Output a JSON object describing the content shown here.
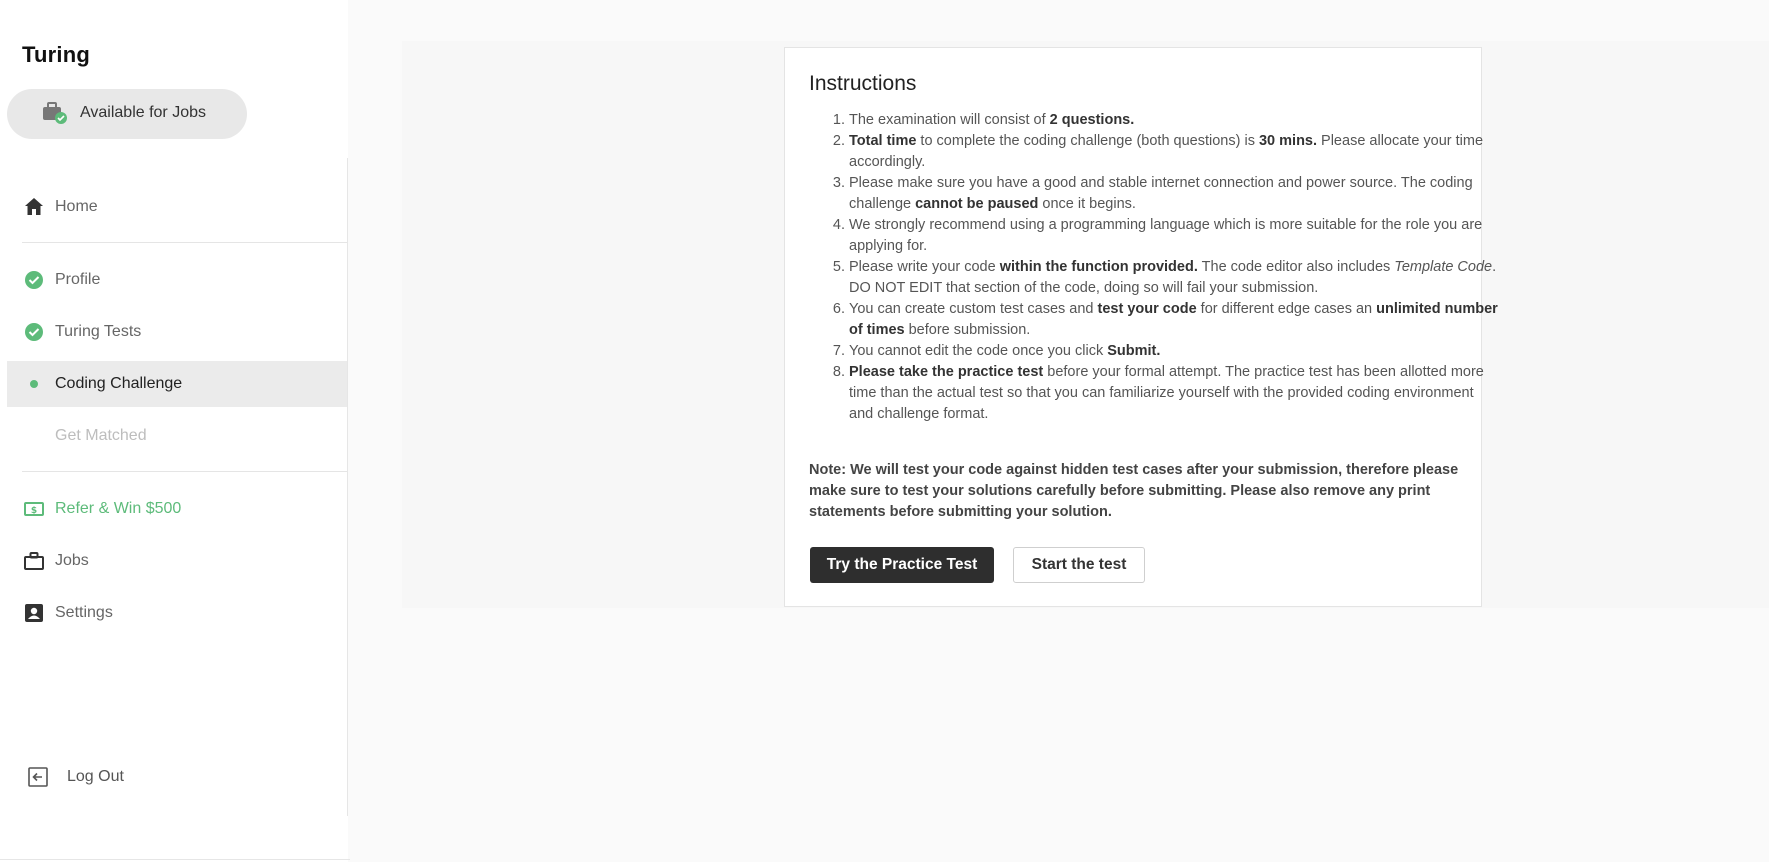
{
  "app": {
    "brand": "Turing"
  },
  "availability": {
    "label": "Available for Jobs",
    "icon": "briefcase-check-icon"
  },
  "sidebar": {
    "items": [
      {
        "label": "Home",
        "icon": "home-icon",
        "state": "normal"
      },
      {
        "label": "Profile",
        "icon": "check-circle-icon",
        "state": "completed"
      },
      {
        "label": "Turing Tests",
        "icon": "check-circle-icon",
        "state": "completed"
      },
      {
        "label": "Coding Challenge",
        "icon": "dot-icon",
        "state": "active"
      },
      {
        "label": "Get Matched",
        "icon": "",
        "state": "disabled"
      },
      {
        "label": "Refer & Win $500",
        "icon": "money-icon",
        "state": "accent"
      },
      {
        "label": "Jobs",
        "icon": "briefcase-icon",
        "state": "normal"
      },
      {
        "label": "Settings",
        "icon": "account-box-icon",
        "state": "normal"
      }
    ],
    "logout_label": "Log Out"
  },
  "instructions": {
    "title": "Instructions",
    "items": [
      [
        {
          "t": "The examination will consist of "
        },
        {
          "t": "2 questions.",
          "b": true
        }
      ],
      [
        {
          "t": "Total time",
          "b": true
        },
        {
          "t": " to complete the coding challenge (both questions) is "
        },
        {
          "t": "30 mins.",
          "b": true
        },
        {
          "t": " Please allocate your time accordingly."
        }
      ],
      [
        {
          "t": "Please make sure you have a good and stable internet connection and power source. The coding challenge "
        },
        {
          "t": "cannot be paused",
          "b": true
        },
        {
          "t": " once it begins."
        }
      ],
      [
        {
          "t": "We strongly recommend using a programming language which is more suitable for the role you are applying for."
        }
      ],
      [
        {
          "t": "Please write your code "
        },
        {
          "t": "within the function provided.",
          "b": true
        },
        {
          "t": " The code editor also includes "
        },
        {
          "t": "Template Code",
          "i": true
        },
        {
          "t": ". DO NOT EDIT that section of the code, doing so will fail your submission."
        }
      ],
      [
        {
          "t": "You can create custom test cases and "
        },
        {
          "t": "test your code",
          "b": true
        },
        {
          "t": " for different edge cases an "
        },
        {
          "t": "unlimited number of times",
          "b": true
        },
        {
          "t": " before submission."
        }
      ],
      [
        {
          "t": "You cannot edit the code once you click "
        },
        {
          "t": "Submit.",
          "b": true
        }
      ],
      [
        {
          "t": "Please take the practice test",
          "b": true
        },
        {
          "t": " before your formal attempt. The practice test has been allotted more time than the actual test so that you can familiarize yourself with the provided coding environment and challenge format."
        }
      ]
    ],
    "note": "Note: We will test your code against hidden test cases after your submission, therefore please make sure to test your solutions carefully before submitting. Please also remove any print statements before submitting your solution.",
    "practice_button": "Try the Practice Test",
    "start_button": "Start the test"
  },
  "colors": {
    "accent_green": "#5dbb7a",
    "dark_button": "#2e2e2e",
    "active_bg": "#ebebeb"
  }
}
